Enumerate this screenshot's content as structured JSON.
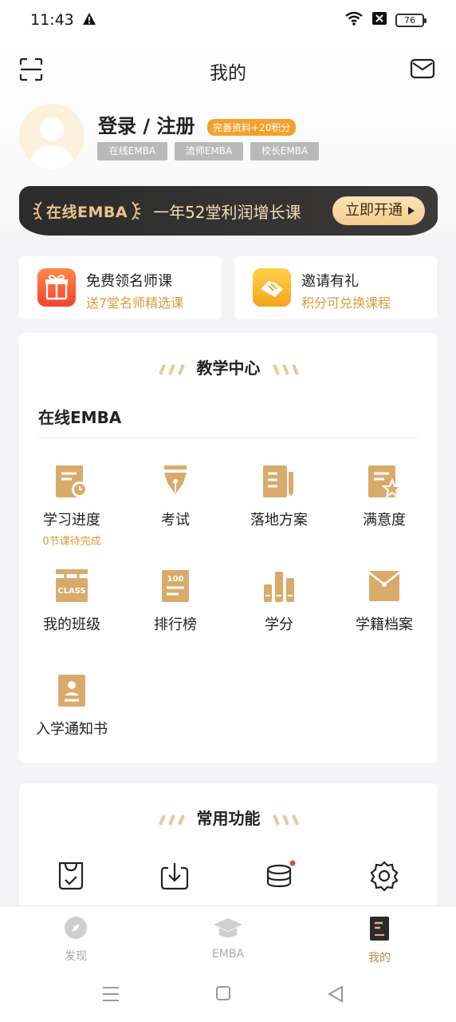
{
  "status": {
    "time": "11:43",
    "battery": "76"
  },
  "header": {
    "title": "我的"
  },
  "profile": {
    "login_label": "登录 / 注册",
    "bonus_badge": "完善资料+20积分",
    "tags": [
      "在线EMBA",
      "流师EMBA",
      "校长EMBA"
    ]
  },
  "banner": {
    "logo": "在线EMBA",
    "text": "一年52堂利润增长课",
    "button": "立即开通"
  },
  "promos": [
    {
      "title": "免费领名师课",
      "subtitle": "送7堂名师精选课",
      "icon": "gift-icon"
    },
    {
      "title": "邀请有礼",
      "subtitle": "积分可兑换课程",
      "icon": "handshake-icon"
    }
  ],
  "teaching": {
    "title": "教学中心",
    "subtitle": "在线EMBA",
    "items": [
      {
        "label": "学习进度",
        "sub": "0节课待完成",
        "icon": "progress-icon"
      },
      {
        "label": "考试",
        "icon": "exam-pen-icon"
      },
      {
        "label": "落地方案",
        "icon": "plan-doc-icon"
      },
      {
        "label": "满意度",
        "icon": "satisfaction-icon"
      },
      {
        "label": "我的班级",
        "icon": "class-icon",
        "icon_text": "CLASS"
      },
      {
        "label": "排行榜",
        "icon": "ranking-icon",
        "icon_text": "100"
      },
      {
        "label": "学分",
        "icon": "credits-icon"
      },
      {
        "label": "学籍档案",
        "icon": "archive-icon"
      },
      {
        "label": "入学通知书",
        "icon": "admission-letter-icon"
      }
    ]
  },
  "common": {
    "title": "常用功能",
    "tools": [
      "shopping-check-icon",
      "download-icon",
      "coins-icon",
      "settings-icon"
    ]
  },
  "tabbar": {
    "items": [
      {
        "label": "发现",
        "icon": "compass-icon"
      },
      {
        "label": "EMBA",
        "icon": "graduation-cap-icon"
      },
      {
        "label": "我的",
        "icon": "profile-book-icon"
      }
    ]
  },
  "colors": {
    "accent": "#d99a3c",
    "badge": "#f4a12c",
    "icon_gold": "#d9ab6a",
    "banner_dark": "#2b2b2b"
  }
}
